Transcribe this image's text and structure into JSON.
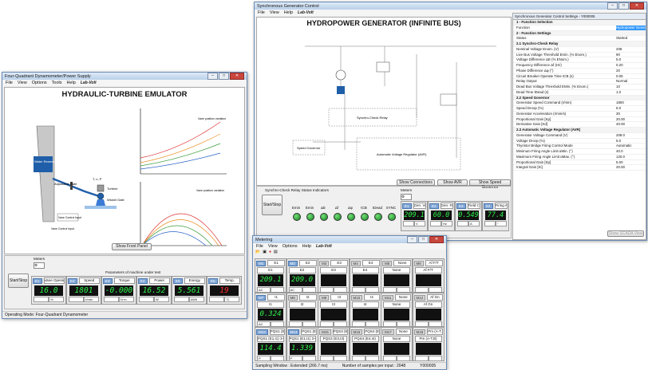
{
  "emulator": {
    "title": "Four-Quadrant Dynamometer/Power Supply",
    "menu": [
      "File",
      "View",
      "Options",
      "Tools",
      "Help"
    ],
    "logo": "Lab-Volt",
    "heading": "HYDRAULIC-TURBINE EMULATOR",
    "diagram": {
      "reservoir": "Water Reservoir",
      "turbine": "Turbine",
      "gate": "Adjustable Gate",
      "wicket": "Wicket Gate",
      "load": "Load / Gen",
      "tailrace": "Vane Control Input",
      "vane": "Vane Position Variation",
      "vanebox": "Vane Control Input",
      "t": "T, n, P"
    },
    "graph_top_note": "Vane position variation",
    "graph_bottom_note": "Vane position variation",
    "show_front_panel": "Show Front Panel",
    "start_stop": "Start/Stop",
    "meters_label": "Meters",
    "params_label": "Parameters of machine under test",
    "meters": [
      {
        "tag": "E1",
        "label": "Vane Openin",
        "value": "16.0",
        "unit": "%"
      },
      {
        "tag": "E2",
        "label": "Speed",
        "value": "1801",
        "unit": "r/min"
      },
      {
        "tag": "E3",
        "label": "Torque",
        "value": "-0.000",
        "unit": "N·m"
      },
      {
        "tag": "E4",
        "label": "Power",
        "value": "16.52",
        "unit": "W"
      },
      {
        "tag": "E5",
        "label": "Energy",
        "value": "5.561",
        "unit": "kWh"
      },
      {
        "tag": "E6",
        "label": "Temp.",
        "value": "19",
        "unit": "°C"
      }
    ],
    "status": "Operating Mode: Four-Quadrant Dynamometer"
  },
  "generator": {
    "title": "Synchronous Generator Control",
    "menu": [
      "File",
      "View",
      "Help"
    ],
    "logo": "Lab-Volt",
    "heading": "HYDROPOWER GENERATOR (INFINITE BUS)",
    "blocks": {
      "sync_relay": "Synchro-Check Relay",
      "speed_gov": "Speed Governor",
      "avr": "Automatic Voltage Regulator (AVR)"
    },
    "buttons": {
      "show_connections": "Show Connections",
      "show_avr": "Show AVR",
      "show_speed_governor": "Show Speed Governor",
      "show_scada": "Show SCADA View"
    },
    "start_stop": "Start/Stop",
    "indicator_title": "Synchro-Check Relay Status Indicators",
    "indicators": [
      "Emin",
      "Emin",
      "ΔE",
      "Δf",
      "Δφ",
      "tCB",
      "tDead",
      "SYNC"
    ],
    "meters_label": "Meters",
    "meters": [
      {
        "tag": "E1",
        "label": "Gen. Voltage",
        "value": "209.1",
        "unit": "V"
      },
      {
        "tag": "E2",
        "label": "Gen. Frequen",
        "value": "60.0",
        "unit": "Hz"
      },
      {
        "tag": "E3",
        "label": "Field Current",
        "value": "0.549",
        "unit": "A"
      },
      {
        "tag": "E4",
        "label": "Firing Angle",
        "value": "77.4",
        "unit": "°"
      }
    ],
    "settings": {
      "title": "Synchronous Generator Control Settings - Y000005",
      "rows": [
        {
          "k": "1 - Function Selection",
          "v": "",
          "sec": true
        },
        {
          "k": "Function",
          "v": "Hydropower Generator (Infinite Bus)",
          "sel": true
        },
        {
          "k": "2 - Function Settings",
          "v": "",
          "sec": true
        },
        {
          "k": "Status",
          "v": "Started"
        },
        {
          "k": "2.1 Synchro-Check Relay",
          "v": "",
          "sec": true
        },
        {
          "k": "Nominal Voltage Enom. (V)",
          "v": "208"
        },
        {
          "k": "Live Bus Voltage Threshold Emin. (% Enom.)",
          "v": "90"
        },
        {
          "k": "Voltage Difference ΔE (% ENom.)",
          "v": "5.0"
        },
        {
          "k": "Frequency Difference Δf (Hz)",
          "v": "0.20"
        },
        {
          "k": "Phase Difference Δφ (°)",
          "v": "20"
        },
        {
          "k": "Circuit Breaker Operate Time tCB (s)",
          "v": "0.05"
        },
        {
          "k": "Relay Output",
          "v": "Normal"
        },
        {
          "k": "Dead Bus Voltage Threshold EMin. (% Enom.)",
          "v": "10"
        },
        {
          "k": "Dead Time tDead (s)",
          "v": "1.0"
        },
        {
          "k": "2.2 Speed Governor",
          "v": "",
          "sec": true
        },
        {
          "k": "Generator Speed Command (r/min)",
          "v": "1800"
        },
        {
          "k": "Speed Droop (%)",
          "v": "5.0"
        },
        {
          "k": "Generator Acceleration (r/min/s)",
          "v": "30"
        },
        {
          "k": "Proportional Gain [Kp]",
          "v": "20.00"
        },
        {
          "k": "Derivative Gain [Kd]",
          "v": "40.00"
        },
        {
          "k": "2.3 Automatic Voltage Regulator (AVR)",
          "v": "",
          "sec": true
        },
        {
          "k": "Generator Voltage Command (V)",
          "v": "208.0"
        },
        {
          "k": "Voltage Droop (%)",
          "v": "5.0"
        },
        {
          "k": "Thyristor Bridge Firing Control Mode",
          "v": "Automatic"
        },
        {
          "k": "Minimum Firing Angle Limit αMin. (°)",
          "v": "40.0"
        },
        {
          "k": "Maximum Firing Angle Limit αMax. (°)",
          "v": "120.0"
        },
        {
          "k": "Proportional Gain [Kp]",
          "v": "5.00"
        },
        {
          "k": "Integral Gain [Ki]",
          "v": "20.00"
        }
      ]
    }
  },
  "metering": {
    "title": "Metering",
    "menu": [
      "File",
      "View",
      "Options",
      "Help"
    ],
    "logo": "Lab-Volt",
    "rows": [
      [
        {
          "tag": "M1",
          "id": "E1",
          "label": "E1",
          "value": "209.1",
          "foot": "AC",
          "on": true
        },
        {
          "tag": "M2",
          "id": "E2",
          "label": "E2",
          "value": "209.0",
          "foot": "AC",
          "on": true
        },
        {
          "tag": "M3",
          "id": "E3",
          "label": "E3",
          "value": "",
          "foot": "",
          "on": false
        },
        {
          "tag": "M4",
          "id": "E4",
          "label": "E4",
          "value": "",
          "foot": "",
          "on": false
        },
        {
          "tag": "M5",
          "id": "None",
          "label": "None",
          "value": "",
          "foot": "",
          "on": false
        },
        {
          "tag": "M6",
          "id": "Af F/T",
          "label": "Af F/T",
          "value": "",
          "foot": "",
          "on": false
        }
      ],
      [
        {
          "tag": "M7",
          "id": "I1",
          "label": "I1",
          "value": "0.324",
          "foot": "AC",
          "on": true
        },
        {
          "tag": "M8",
          "id": "I2",
          "label": "I2",
          "value": "",
          "foot": "",
          "on": false
        },
        {
          "tag": "M9",
          "id": "I3",
          "label": "I3",
          "value": "",
          "foot": "",
          "on": false
        },
        {
          "tag": "M10",
          "id": "I4",
          "label": "I4",
          "value": "",
          "foot": "",
          "on": false
        },
        {
          "tag": "M11",
          "id": "None",
          "label": "None",
          "value": "",
          "foot": "",
          "on": false
        },
        {
          "tag": "M12",
          "id": "Af Gn",
          "label": "Af Gn",
          "value": "",
          "foot": "",
          "on": false
        }
      ],
      [
        {
          "tag": "M13",
          "id": "PQS1 (E1,I1)",
          "label": "PQS1 (E1,I1) 3~",
          "value": "114.4",
          "foot": "P",
          "on": true
        },
        {
          "tag": "M14",
          "id": "PQS1 (E1,I1)",
          "label": "PQS1 (E1,I1) 3~",
          "value": "1.339",
          "foot": "P",
          "on": true
        },
        {
          "tag": "M15",
          "id": "PQS3 (E3,I3)",
          "label": "PQS3 (E3,I3)",
          "value": "",
          "foot": "",
          "on": false
        },
        {
          "tag": "M16",
          "id": "PQS4 (E4,I4)",
          "label": "PQS4 (E4,I4)",
          "value": "",
          "foot": "",
          "on": false
        },
        {
          "tag": "M17",
          "id": "None",
          "label": "None",
          "value": "",
          "foot": "",
          "on": false
        },
        {
          "tag": "M18",
          "id": "Pm (A-T,B)",
          "label": "Pm (A-T,B)",
          "value": "",
          "foot": "",
          "on": false
        }
      ]
    ],
    "status": [
      "Sampling Window : Extended (266.7 ms)",
      "Number of samples per input : 2048",
      "Y000005"
    ]
  },
  "colors": {
    "accent": "#7fa6d6",
    "lcd_green": "#2ef04a",
    "lcd_red": "#ff2a2a"
  }
}
